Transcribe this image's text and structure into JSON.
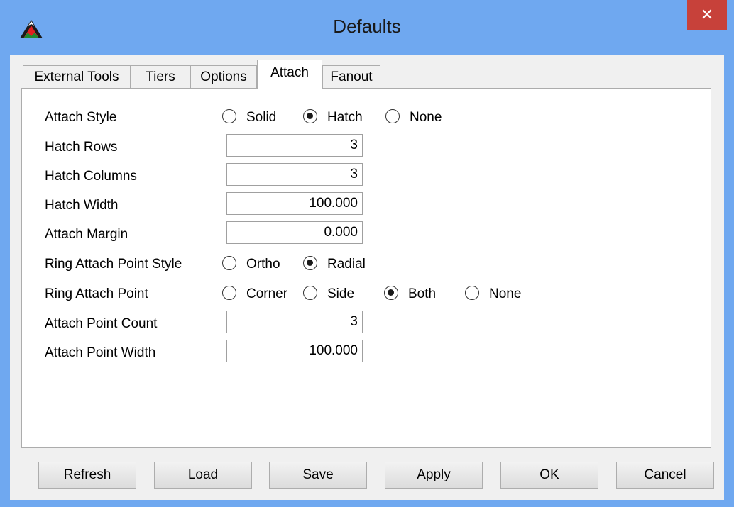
{
  "window": {
    "title": "Defaults",
    "close_glyph": "✕"
  },
  "tabs": [
    {
      "label": "External Tools",
      "active": false
    },
    {
      "label": "Tiers",
      "active": false
    },
    {
      "label": "Options",
      "active": false
    },
    {
      "label": "Attach",
      "active": true
    },
    {
      "label": "Fanout",
      "active": false
    }
  ],
  "form": {
    "attach_style": {
      "label": "Attach Style",
      "options": [
        "Solid",
        "Hatch",
        "None"
      ],
      "selected": "Hatch"
    },
    "hatch_rows": {
      "label": "Hatch Rows",
      "value": "3"
    },
    "hatch_columns": {
      "label": "Hatch Columns",
      "value": "3"
    },
    "hatch_width": {
      "label": "Hatch Width",
      "value": "100.000"
    },
    "attach_margin": {
      "label": "Attach Margin",
      "value": "0.000"
    },
    "ring_attach_point_style": {
      "label": "Ring Attach Point Style",
      "options": [
        "Ortho",
        "Radial"
      ],
      "selected": "Radial"
    },
    "ring_attach_point": {
      "label": "Ring Attach Point",
      "options": [
        "Corner",
        "Side",
        "Both",
        "None"
      ],
      "selected": "Both"
    },
    "attach_point_count": {
      "label": "Attach Point Count",
      "value": "3"
    },
    "attach_point_width": {
      "label": "Attach Point Width",
      "value": "100.000"
    }
  },
  "buttons": {
    "refresh": "Refresh",
    "load": "Load",
    "save": "Save",
    "apply": "Apply",
    "ok": "OK",
    "cancel": "Cancel"
  },
  "colors": {
    "titlebar": "#6fa8f0",
    "close": "#c7413a"
  },
  "icons": {
    "app": "mountain-logo-icon",
    "close": "close-icon"
  }
}
